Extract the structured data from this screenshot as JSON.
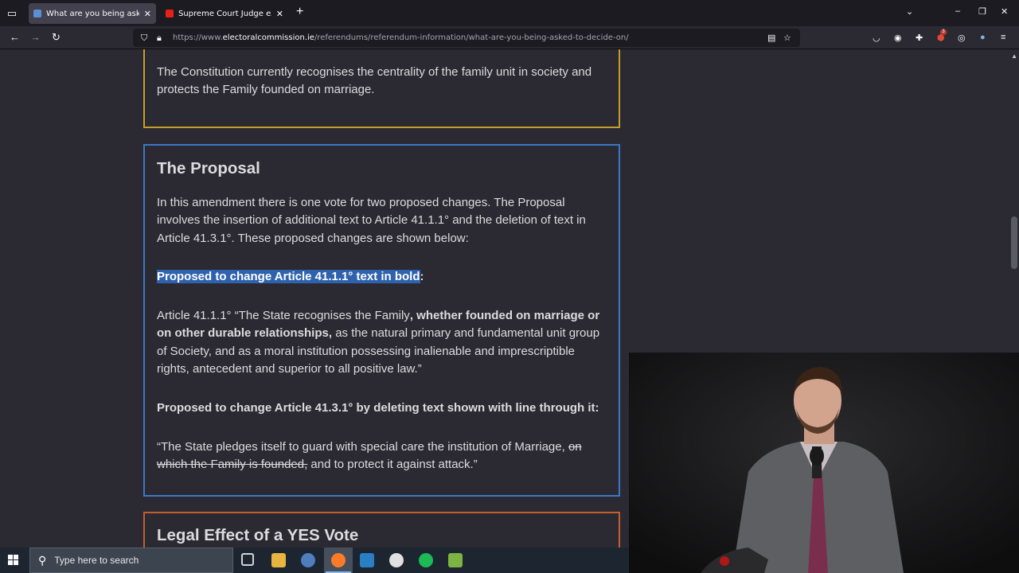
{
  "browser": {
    "tabs": [
      {
        "title": "What are you being asked to decide on",
        "active": true,
        "favicon_color": "#5b8fd6"
      },
      {
        "title": "Supreme Court Judge explains",
        "active": false,
        "favicon_color": "#e62117"
      }
    ],
    "url_domain_prefix": "https://www.",
    "url_domain": "electoralcommission.ie",
    "url_path": "/referendums/referendum-information/what-are-you-being-asked-to-decide-on/",
    "extension_badge": "3"
  },
  "page": {
    "intro_card": {
      "text": "The Constitution currently recognises the centrality of the family unit in society and protects the Family founded on marriage."
    },
    "proposal_card": {
      "heading": "The Proposal",
      "intro": "In this amendment there is one vote for two proposed changes. The Proposal involves the insertion of additional text to Article 41.1.1° and the deletion of text in Article 41.3.1°. These proposed changes are shown below:",
      "change1_label_selected": "Proposed to change Article 41.1.1° text in bold",
      "change1_label_tail": ":",
      "article1_part1": "Article 41.1.1° “The State recognises the Family",
      "article1_bold": ", whether founded on marriage or on other durable relationships,",
      "article1_part2": " as the natural primary and fundamental unit group of Society, and as a moral institution possessing inalienable and imprescriptible rights, antecedent and superior to all positive law.”",
      "change2_label": "Proposed to change Article 41.3.1° by deleting text shown with line through it:",
      "article2_part1": "“The State pledges itself to guard with special care the institution of Marriage, ",
      "article2_struck": "on which the Family is founded,",
      "article2_part2": " and to protect it against attack.”"
    },
    "next_card": {
      "heading": "Legal Effect of a YES Vote"
    }
  },
  "taskbar": {
    "search_placeholder": "Type here to search"
  },
  "colors": {
    "yellow_border": "#c59d2b",
    "blue_border": "#3d77c5",
    "orange_border": "#c25f2c",
    "selection": "#2f62ad"
  }
}
